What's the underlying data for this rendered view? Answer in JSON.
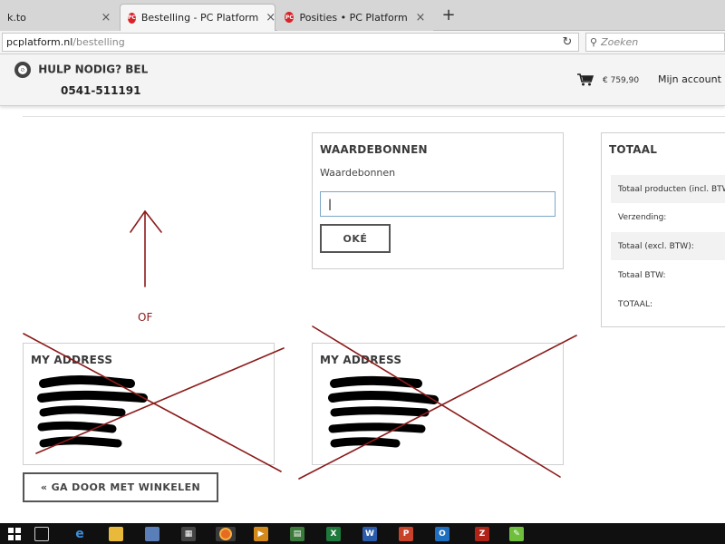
{
  "browser": {
    "tabs": [
      {
        "title": "k.to",
        "favicon": "",
        "active": false
      },
      {
        "title": "Bestelling - PC Platform",
        "favicon": "PC",
        "active": true
      },
      {
        "title": "Posities • PC Platform",
        "favicon": "PC",
        "active": false
      }
    ],
    "new_tab": "+",
    "close": "×",
    "url_host": "pcplatform.nl",
    "url_path": "/bestelling",
    "search_placeholder": "Zoeken"
  },
  "header": {
    "help_text": "HULP NODIG? BEL",
    "phone": "0541-511191",
    "cart_amount": "€ 759,90",
    "account": "Mijn account"
  },
  "voucher": {
    "title": "WAARDEBONNEN",
    "label": "Waardebonnen",
    "input_value": "|",
    "ok_button": "OKÉ"
  },
  "totals": {
    "title": "TOTAAL",
    "rows": [
      "Totaal producten (incl. BTW",
      "Verzending:",
      "Totaal (excl. BTW):",
      "Totaal BTW:",
      "TOTAAL:"
    ]
  },
  "addresses": {
    "left_title": "MY ADDRESS",
    "right_title": "MY ADDRESS"
  },
  "continue_button": "« GA DOOR MET WINKELEN",
  "annotation": {
    "or_label": "OF",
    "color": "#8b1a1a"
  },
  "taskbar": {
    "icons": [
      "windows-icon",
      "task-view-icon",
      "edge-icon",
      "file-explorer-icon",
      "network-icon",
      "store-icon",
      "firefox-icon",
      "media-icon",
      "calculator-icon",
      "excel-icon",
      "word-icon",
      "powerpoint-icon",
      "outlook-icon",
      "filezilla-icon",
      "notepad-icon"
    ]
  }
}
